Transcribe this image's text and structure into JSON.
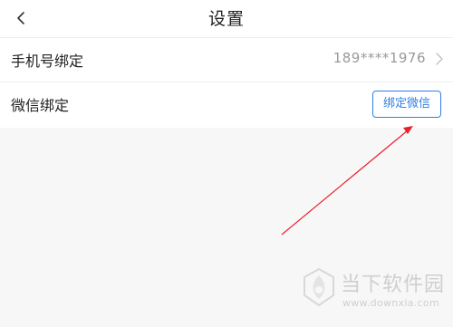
{
  "header": {
    "back_icon": "chevron-left",
    "title": "设置"
  },
  "settings": {
    "phone": {
      "label": "手机号绑定",
      "value": "189****1976",
      "icon": "chevron-right"
    },
    "wechat": {
      "label": "微信绑定",
      "button_label": "绑定微信"
    }
  },
  "annotation": {
    "type": "red-arrow",
    "color": "#e8202a",
    "points_to": "bind-wechat-button"
  },
  "watermark": {
    "name": "当下软件园",
    "url": "www.downxia.com"
  },
  "colors": {
    "accent": "#2f80e7",
    "background": "#f7f7f7",
    "secondary_text": "#9a9a9a"
  }
}
